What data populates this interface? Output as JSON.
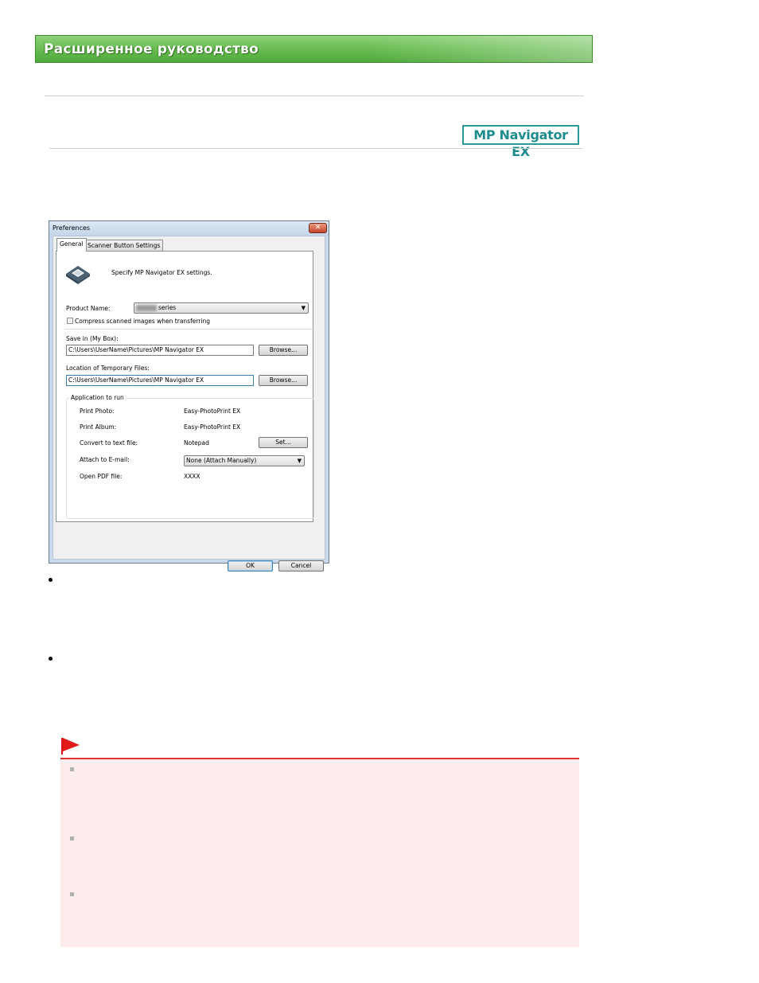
{
  "header": {
    "title": "Расширенное руководство"
  },
  "logo": {
    "text": "MP Navigator EX"
  },
  "dialog": {
    "title": "Preferences",
    "close_glyph": "✕",
    "tabs": [
      {
        "label": "General",
        "active": true
      },
      {
        "label": "Scanner Button Settings",
        "active": false
      }
    ],
    "description": "Specify MP Navigator EX settings.",
    "product_name_label": "Product Name:",
    "product_name_value": "series",
    "compress_label": "Compress scanned images when transferring",
    "compress_checked": false,
    "save_in_label": "Save in (My Box):",
    "save_in_value": "C:\\Users\\UserName\\Pictures\\MP Navigator EX",
    "browse_label": "Browse...",
    "temp_files_label": "Location of Temporary Files:",
    "temp_files_value": "C:\\Users\\UserName\\Pictures\\MP Navigator EX",
    "app_group_title": "Application to run",
    "apps": [
      {
        "label": "Print Photo:",
        "value": "Easy-PhotoPrint EX"
      },
      {
        "label": "Print Album:",
        "value": "Easy-PhotoPrint EX"
      },
      {
        "label": "Convert to text file:",
        "value": "Notepad"
      },
      {
        "label": "Attach to E-mail:",
        "value": "None (Attach Manually)"
      },
      {
        "label": "Open PDF file:",
        "value": "XXXX"
      }
    ],
    "set_label": "Set...",
    "ok_label": "OK",
    "cancel_label": "Cancel"
  },
  "colors": {
    "header_green": "#6cbf55",
    "logo_teal": "#1e8c8c",
    "note_red": "#e03030",
    "note_bg": "#fcecec"
  },
  "icons": [
    "scanner-icon",
    "bullet-icon",
    "flag-icon",
    "square-bullet-icon"
  ]
}
